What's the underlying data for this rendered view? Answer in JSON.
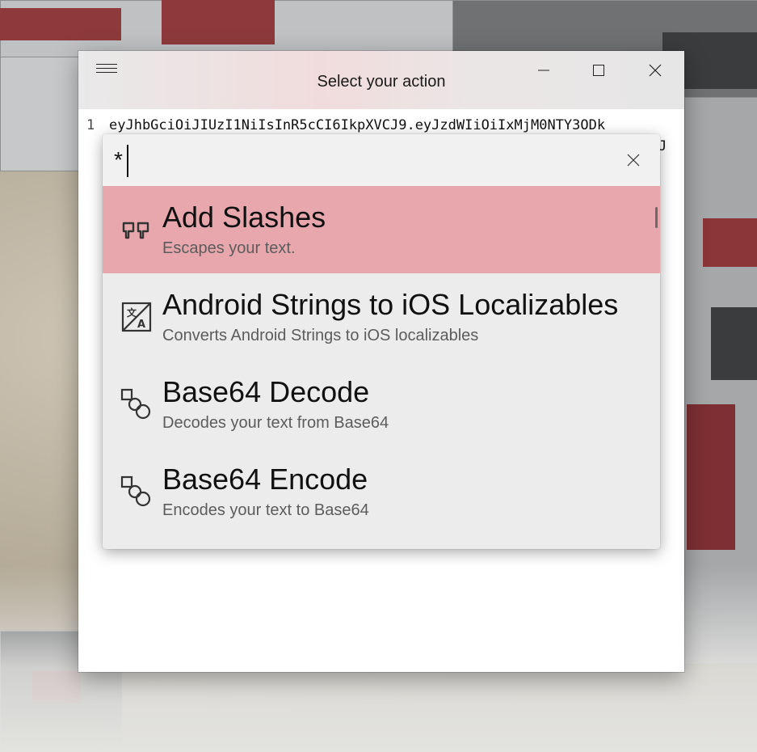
{
  "window": {
    "title": "Select your action",
    "buttons": {
      "minimize": "minimize",
      "maximize": "maximize",
      "close": "close"
    }
  },
  "editor": {
    "line_number": "1",
    "line_text": "eyJhbGciOiJIUzI1NiIsInR5cCI6IkpXVCJ9.eyJzdWIiOiIxMjM0NTY3ODk",
    "line2_tail": "J"
  },
  "palette": {
    "search_value": "*",
    "items": [
      {
        "title": "Add Slashes",
        "description": "Escapes your text.",
        "icon": "quote-icon",
        "selected": true
      },
      {
        "title": "Android Strings to iOS Localizables",
        "description": "Converts Android Strings to iOS localizables",
        "icon": "translate-icon",
        "selected": false
      },
      {
        "title": "Base64 Decode",
        "description": "Decodes your text from Base64",
        "icon": "transform-icon",
        "selected": false
      },
      {
        "title": "Base64 Encode",
        "description": "Encodes your text to Base64",
        "icon": "transform-icon",
        "selected": false
      }
    ]
  },
  "colors": {
    "selected_item": "#e8a7ad",
    "palette_background": "#ececec"
  }
}
